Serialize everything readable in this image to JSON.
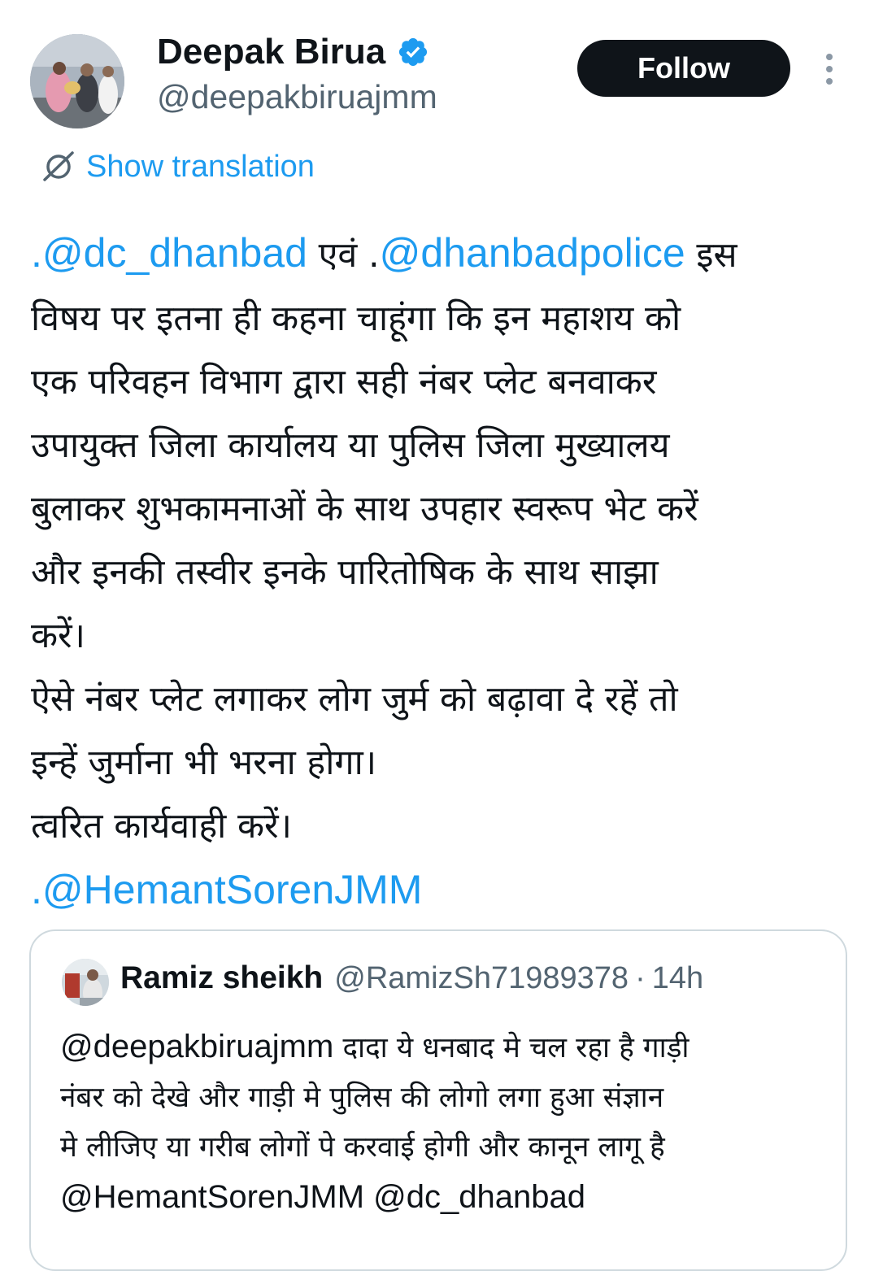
{
  "author": {
    "name": "Deepak Birua",
    "handle": "@deepakbiruajmm",
    "verified": true
  },
  "actions": {
    "follow_label": "Follow",
    "more_icon": "more-vertical-icon"
  },
  "translation": {
    "label": "Show translation",
    "icon": "translate-icon"
  },
  "tweet": {
    "line1_prefix": ".",
    "mention1": "@dc_dhanbad",
    "line1_mid": " एवं .",
    "mention2": "@dhanbadpolice",
    "line1_suffix": " इस",
    "lines": [
      "विषय पर इतना ही कहना चाहूंगा कि इन महाशय को",
      "एक परिवहन विभाग द्वारा सही नंबर प्लेट बनवाकर",
      "उपायुक्त जिला कार्यालय या पुलिस जिला मुख्यालय",
      "बुलाकर शुभकामनाओं के साथ उपहार स्वरूप भेट करें",
      "और इनकी तस्वीर इनके पारितोषिक के साथ साझा",
      "करें।",
      "ऐसे नंबर प्लेट लगाकर लोग जुर्म को बढ़ावा दे रहें तो",
      "इन्हें जुर्माना भी भरना होगा।",
      "त्वरित कार्यवाही करें।"
    ],
    "last_prefix": ".",
    "last_mention": "@HemantSorenJMM"
  },
  "quote": {
    "name": "Ramiz sheikh",
    "handle": "@RamizSh71989378",
    "separator": "·",
    "time": "14h",
    "mention_start": "@deepakbiruajmm",
    "line1_rest": "  दादा ये धनबाद मे चल रहा है गाड़ी",
    "line2": "नंबर को देखे और गाड़ी मे पुलिस की लोगो लगा हुआ संज्ञान",
    "line3": "मे लीजिए या गरीब लोगों पे करवाई होगी और कानून लागू है",
    "line4": "@HemantSorenJMM @dc_dhanbad"
  },
  "colors": {
    "link": "#1d9bf0",
    "text": "#0f1419",
    "secondary": "#536471",
    "button_bg": "#0f1419",
    "border": "#cfd9de"
  }
}
